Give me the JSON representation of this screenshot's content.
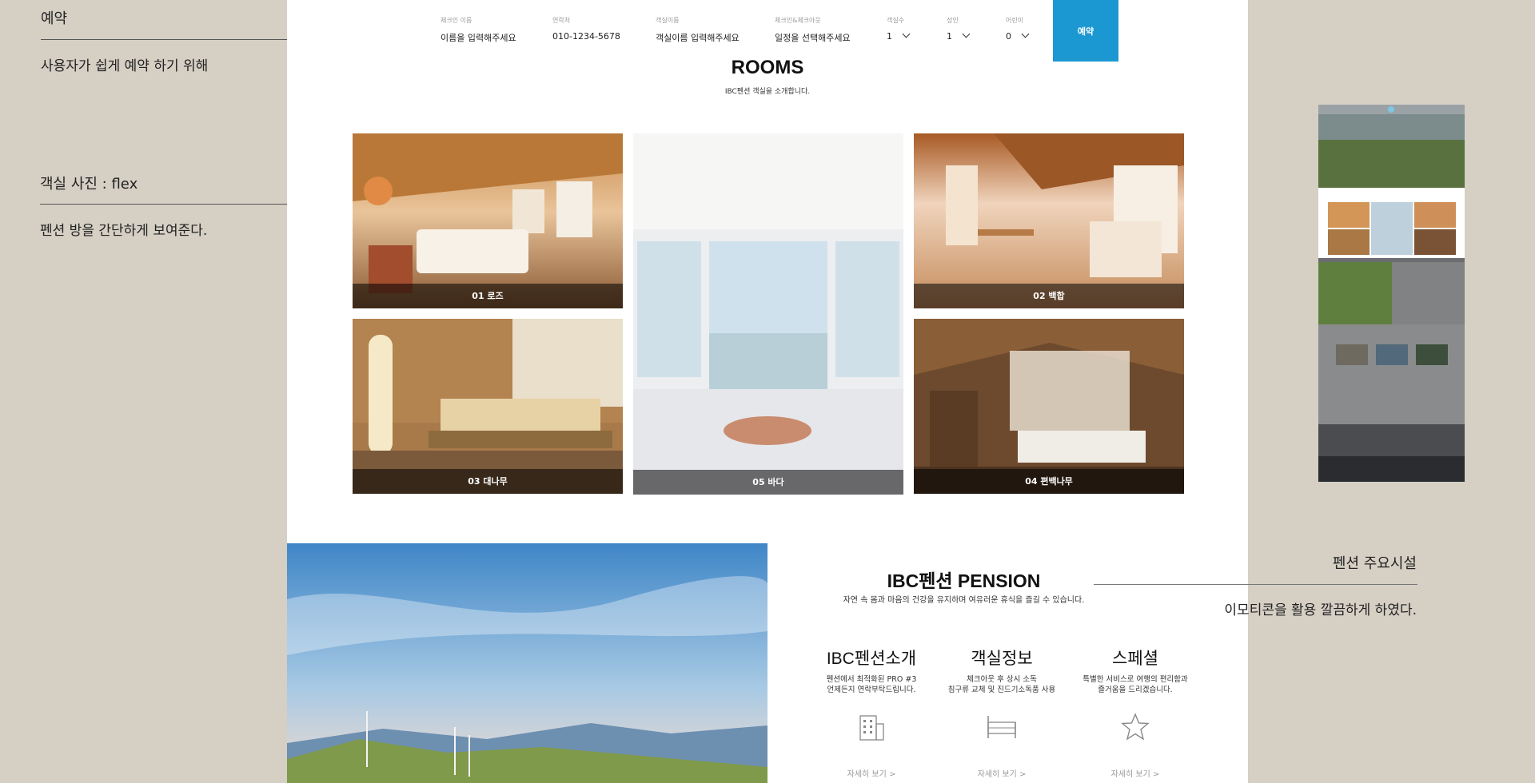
{
  "notes": {
    "booking_title": "예약",
    "booking_desc": "사용자가 쉽게 예약 하기 위해",
    "rooms_title": "객실 사진 : flex",
    "rooms_desc": "펜션 방을 간단하게 보여준다.",
    "facility_title": "펜션 주요시설",
    "facility_desc": "이모티콘을 활용 깔끔하게 하였다."
  },
  "booking": {
    "fields": [
      {
        "label": "체크인 이름",
        "value": "이름을 입력해주세요"
      },
      {
        "label": "연락처",
        "value": "010-1234-5678"
      },
      {
        "label": "객실이름",
        "value": "객실이름 입력해주세요"
      },
      {
        "label": "체크인&체크아웃",
        "value": "일정을 선택해주세요"
      },
      {
        "label": "객실수",
        "value": "1"
      },
      {
        "label": "성인",
        "value": "1"
      },
      {
        "label": "어린이",
        "value": "0"
      }
    ],
    "button_label": "예약"
  },
  "rooms": {
    "title": "ROOMS",
    "subtitle": "IBC펜션 객실을 소개합니다.",
    "items": [
      {
        "caption": "01 로즈"
      },
      {
        "caption": "05 바다"
      },
      {
        "caption": "02 백합"
      },
      {
        "caption": "03 대나무"
      },
      {
        "caption": "04 편백나무"
      }
    ]
  },
  "pension": {
    "title": "IBC펜션 PENSION",
    "subtitle": "자연 속 몸과 마음의 건강을 유지하며 여유러운 휴식을 즐길 수 있습니다.",
    "facilities": [
      {
        "title": "IBC펜션소개",
        "desc": "펜션에서 최적화된 PRO #3\n언제든지 연락부탁드립니다.",
        "icon": "building-icon",
        "more": "자세히 보기  >"
      },
      {
        "title": "객실정보",
        "desc": "체크아웃 후 상시 소독\n침구류 교체 및 진드기소독품 사용",
        "icon": "bed-icon",
        "more": "자세히 보기  >"
      },
      {
        "title": "스페셜",
        "desc": "특별한 서비스로 여행의 편리함과\n즐거움을 드리겠습니다.",
        "icon": "star-icon",
        "more": "자세히 보기  >"
      }
    ]
  },
  "colors": {
    "background": "#d5cfc4",
    "accent": "#1b98d1"
  }
}
